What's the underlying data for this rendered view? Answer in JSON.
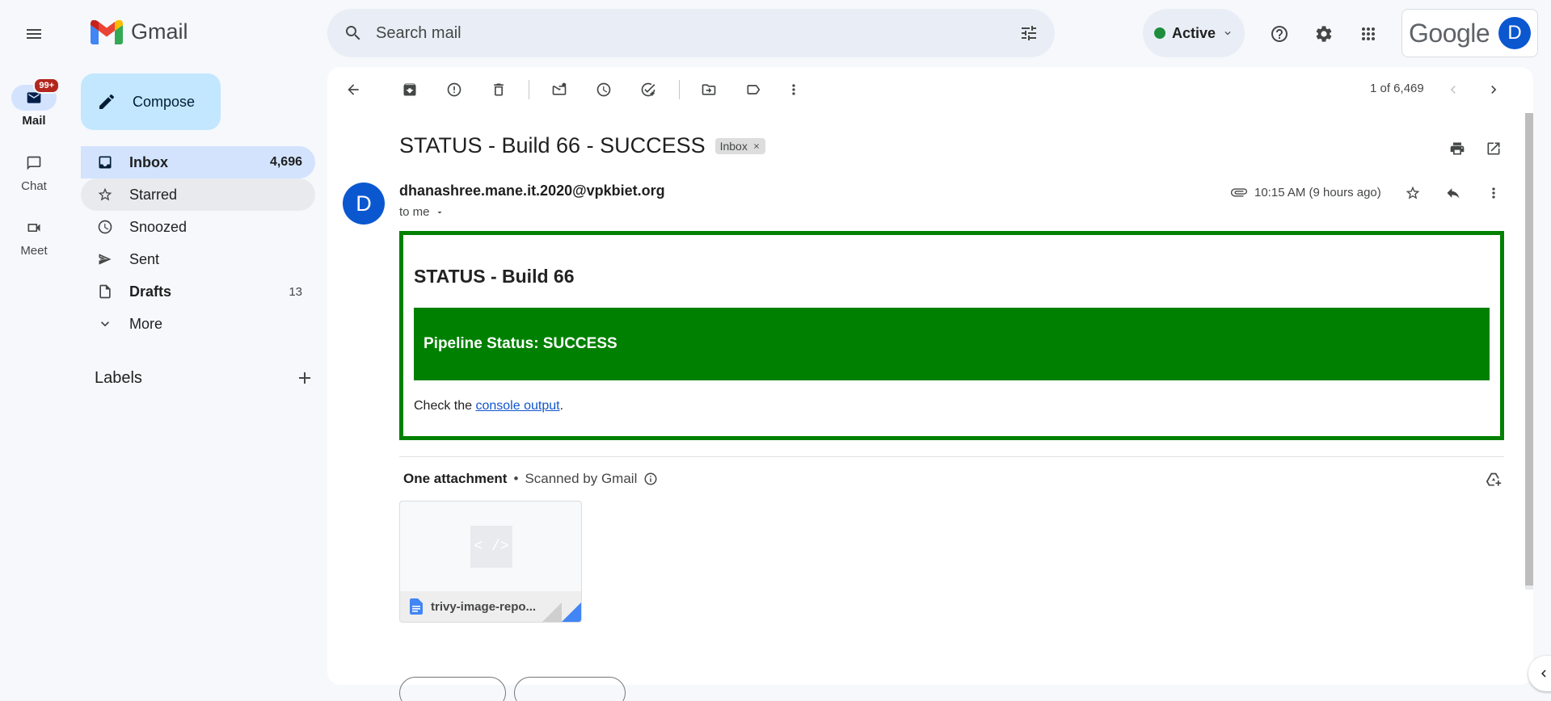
{
  "app": {
    "name": "Gmail"
  },
  "rail": [
    {
      "label": "Mail",
      "badge": "99+"
    },
    {
      "label": "Chat"
    },
    {
      "label": "Meet"
    }
  ],
  "compose_label": "Compose",
  "nav": [
    {
      "label": "Inbox",
      "count": "4,696"
    },
    {
      "label": "Starred",
      "count": ""
    },
    {
      "label": "Snoozed",
      "count": ""
    },
    {
      "label": "Sent",
      "count": ""
    },
    {
      "label": "Drafts",
      "count": "13"
    },
    {
      "label": "More",
      "count": ""
    }
  ],
  "labels_header": "Labels",
  "search": {
    "placeholder": "Search mail"
  },
  "status": {
    "label": "Active",
    "color": "#1e8e3e"
  },
  "account": {
    "brand": "Google",
    "initial": "D"
  },
  "pager": "1 of 6,469",
  "message": {
    "subject": "STATUS - Build 66 - SUCCESS",
    "label_chip": "Inbox",
    "sender_initial": "D",
    "sender": "dhanashree.mane.it.2020@vpkbiet.org",
    "to": "to me",
    "time": "10:15 AM (9 hours ago)",
    "body": {
      "title": "STATUS - Build 66",
      "banner": "Pipeline Status: SUCCESS",
      "check_prefix": "Check the ",
      "link": "console output",
      "check_suffix": ".",
      "accent": "#008000"
    }
  },
  "attachments": {
    "header": "One attachment",
    "scanned": "Scanned by Gmail",
    "files": [
      {
        "name": "trivy-image-repo...",
        "thumb": "< />"
      }
    ]
  }
}
